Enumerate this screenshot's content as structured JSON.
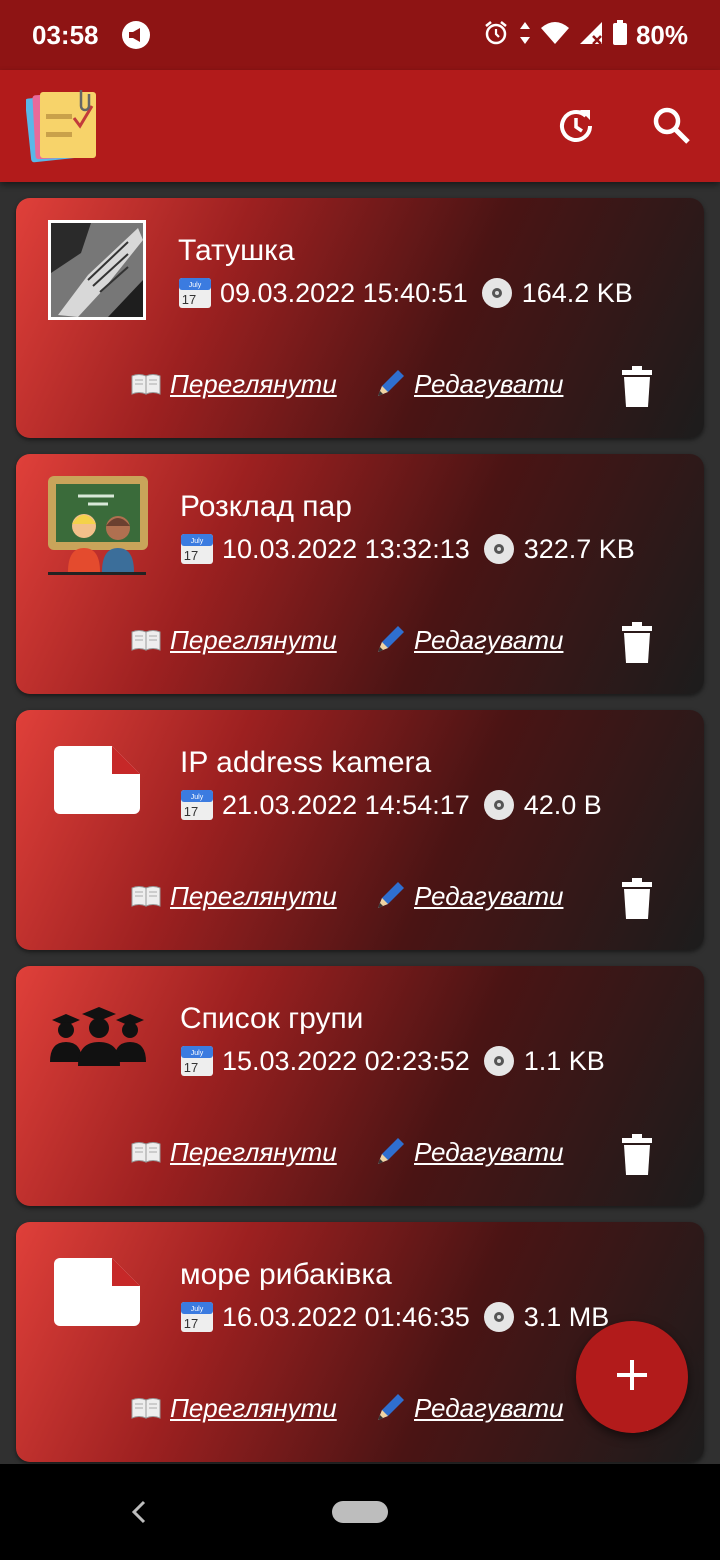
{
  "status_bar": {
    "time": "03:58",
    "battery": "80%",
    "icons": [
      "megaphone-icon",
      "alarm-icon",
      "data-arrows-icon",
      "wifi-icon",
      "signal-icon",
      "battery-icon"
    ]
  },
  "app_bar": {
    "logo": "notes-logo",
    "actions": [
      "history-icon",
      "search-icon"
    ]
  },
  "notes": [
    {
      "title": "Татушка",
      "date": "09.03.2022 15:40:51",
      "size": "164.2 KB",
      "thumb": "tattoo-photo",
      "view_label": "Переглянути",
      "edit_label": "Редагувати"
    },
    {
      "title": "Розклад пар",
      "date": "10.03.2022 13:32:13",
      "size": "322.7 KB",
      "thumb": "classroom-image",
      "view_label": "Переглянути",
      "edit_label": "Редагувати"
    },
    {
      "title": "IP address kamera",
      "date": "21.03.2022 14:54:17",
      "size": "42.0 B",
      "thumb": "blank-file-icon",
      "view_label": "Переглянути",
      "edit_label": "Редагувати"
    },
    {
      "title": "Список групи",
      "date": "15.03.2022 02:23:52",
      "size": "1.1 KB",
      "thumb": "graduates-icon",
      "view_label": "Переглянути",
      "edit_label": "Редагувати"
    },
    {
      "title": "море рибаківка",
      "date": "16.03.2022 01:46:35",
      "size": "3.1 MB",
      "thumb": "blank-file-icon",
      "view_label": "Переглянути",
      "edit_label": "Редагувати"
    }
  ],
  "calendar_icon": {
    "month": "July",
    "day": "17"
  },
  "fab": {
    "icon": "plus-icon"
  },
  "colors": {
    "status_bar": "#8e1414",
    "app_bar": "#b21b1b",
    "background": "#303030",
    "fab": "#b21b1b"
  }
}
